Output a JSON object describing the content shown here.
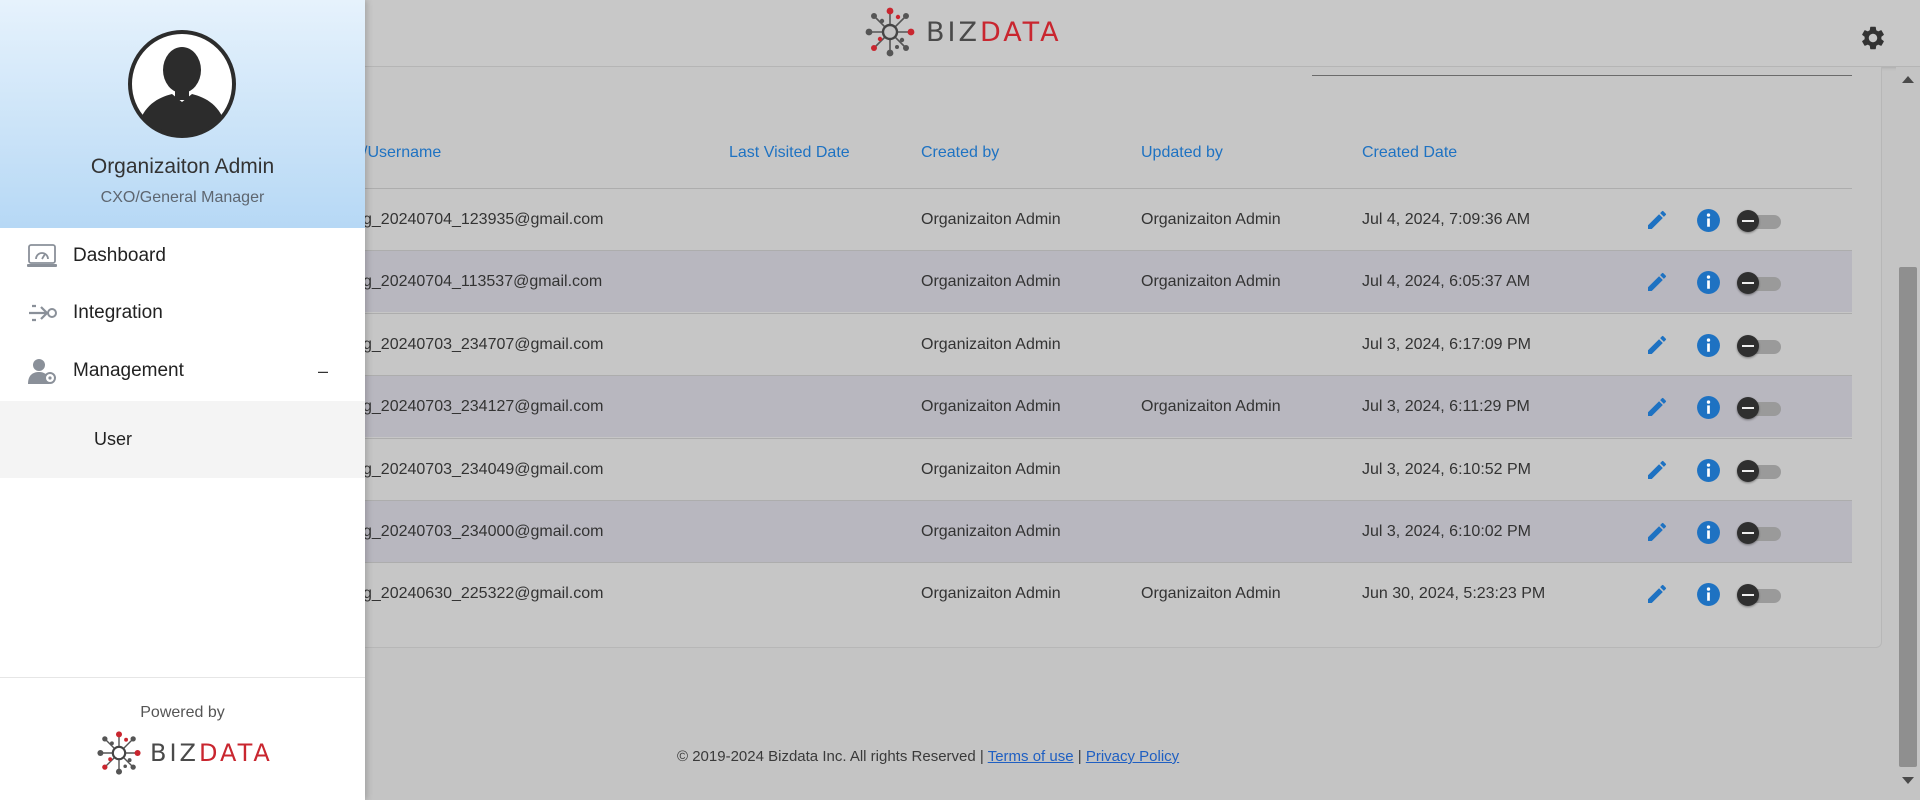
{
  "brand": {
    "name_part1": "BIZ",
    "name_part2": "DATA",
    "accent_red": "#c9262f",
    "accent_blue": "#1e72c2"
  },
  "header": {
    "settings_icon": "gear-icon"
  },
  "table": {
    "columns": [
      "/Username",
      "Last Visited Date",
      "Created by",
      "Updated by",
      "Created Date"
    ],
    "rows": [
      {
        "username": "g_20240704_123935@gmail.com",
        "last_visited": "",
        "created_by": "Organizaiton Admin",
        "updated_by": "Organizaiton Admin",
        "created_date": "Jul 4, 2024, 7:09:36 AM"
      },
      {
        "username": "g_20240704_113537@gmail.com",
        "last_visited": "",
        "created_by": "Organizaiton Admin",
        "updated_by": "Organizaiton Admin",
        "created_date": "Jul 4, 2024, 6:05:37 AM"
      },
      {
        "username": "g_20240703_234707@gmail.com",
        "last_visited": "",
        "created_by": "Organizaiton Admin",
        "updated_by": "",
        "created_date": "Jul 3, 2024, 6:17:09 PM"
      },
      {
        "username": "g_20240703_234127@gmail.com",
        "last_visited": "",
        "created_by": "Organizaiton Admin",
        "updated_by": "Organizaiton Admin",
        "created_date": "Jul 3, 2024, 6:11:29 PM"
      },
      {
        "username": "g_20240703_234049@gmail.com",
        "last_visited": "",
        "created_by": "Organizaiton Admin",
        "updated_by": "",
        "created_date": "Jul 3, 2024, 6:10:52 PM"
      },
      {
        "username": "g_20240703_234000@gmail.com",
        "last_visited": "",
        "created_by": "Organizaiton Admin",
        "updated_by": "",
        "created_date": "Jul 3, 2024, 6:10:02 PM"
      },
      {
        "username": "g_20240630_225322@gmail.com",
        "last_visited": "",
        "created_by": "Organizaiton Admin",
        "updated_by": "Organizaiton Admin",
        "created_date": "Jun 30, 2024, 5:23:23 PM"
      }
    ],
    "row_actions": [
      "edit-icon",
      "info-icon",
      "status-toggle"
    ]
  },
  "footer": {
    "copyright": "© 2019-2024 Bizdata Inc. All rights Reserved |",
    "terms_link": "Terms of use",
    "separator": "|",
    "privacy_link": "Privacy Policy"
  },
  "drawer": {
    "profile": {
      "name": "Organizaiton Admin",
      "role": "CXO/General Manager",
      "avatar_icon": "user-avatar-icon"
    },
    "nav": [
      {
        "label": "Dashboard",
        "icon": "dashboard-icon"
      },
      {
        "label": "Integration",
        "icon": "integration-icon"
      },
      {
        "label": "Management",
        "icon": "management-icon",
        "expanded_indicator": "–"
      }
    ],
    "submenu": [
      {
        "label": "User"
      }
    ],
    "powered_by": "Powered by"
  }
}
